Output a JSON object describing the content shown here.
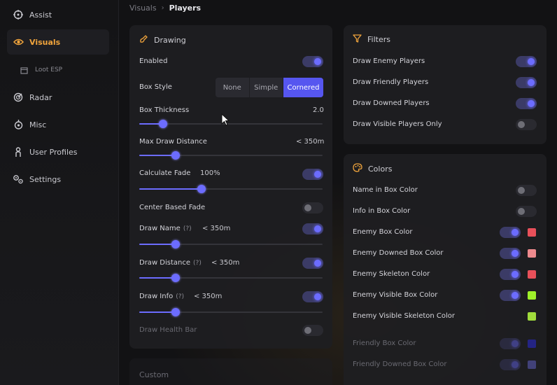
{
  "sidebar": {
    "items": [
      {
        "label": "Assist",
        "icon": "crosshair-icon"
      },
      {
        "label": "Visuals",
        "icon": "eye-icon"
      },
      {
        "label": "Loot ESP",
        "icon": "box-icon"
      },
      {
        "label": "Radar",
        "icon": "radar-icon"
      },
      {
        "label": "Misc",
        "icon": "drop-icon"
      },
      {
        "label": "User Profiles",
        "icon": "user-icon"
      },
      {
        "label": "Settings",
        "icon": "gear-icon"
      }
    ],
    "active_color": "#f0a43c"
  },
  "breadcrumb": {
    "parent": "Visuals",
    "separator": "›",
    "current": "Players"
  },
  "drawing": {
    "title": "Drawing",
    "enabled_label": "Enabled",
    "enabled": true,
    "box_style_label": "Box Style",
    "box_style_options": [
      "None",
      "Simple",
      "Cornered"
    ],
    "box_style_selected": "Cornered",
    "box_thickness_label": "Box Thickness",
    "box_thickness_value": "2.0",
    "box_thickness_fraction": 0.13,
    "max_draw_distance_label": "Max Draw Distance",
    "max_draw_distance_value": "< 350m",
    "max_draw_distance_fraction": 0.2,
    "calculate_fade_label": "Calculate Fade",
    "calculate_fade_value": "100%",
    "calculate_fade_enabled": true,
    "calculate_fade_fraction": 0.34,
    "center_based_fade_label": "Center Based Fade",
    "center_based_fade_enabled": false,
    "draw_name_label": "Draw Name",
    "draw_name_help": "(?)",
    "draw_name_value": "< 350m",
    "draw_name_enabled": true,
    "draw_name_fraction": 0.2,
    "draw_distance_label": "Draw Distance",
    "draw_distance_help": "(?)",
    "draw_distance_value": "< 350m",
    "draw_distance_enabled": true,
    "draw_distance_fraction": 0.2,
    "draw_info_label": "Draw Info",
    "draw_info_help": "(?)",
    "draw_info_value": "< 350m",
    "draw_info_enabled": true,
    "draw_info_fraction": 0.2,
    "draw_health_bar_label": "Draw Health Bar",
    "draw_health_bar_enabled": false
  },
  "custom": {
    "title": "Custom"
  },
  "filters": {
    "title": "Filters",
    "items": [
      {
        "label": "Draw Enemy Players",
        "enabled": true
      },
      {
        "label": "Draw Friendly Players",
        "enabled": true
      },
      {
        "label": "Draw Downed Players",
        "enabled": true
      },
      {
        "label": "Draw Visible Players Only",
        "enabled": false
      }
    ]
  },
  "colors": {
    "title": "Colors",
    "items": [
      {
        "label": "Name in Box Color",
        "toggle": false,
        "color": null
      },
      {
        "label": "Info in Box Color",
        "toggle": false,
        "color": null
      },
      {
        "label": "Enemy Box Color",
        "toggle": true,
        "color": "#e8505a"
      },
      {
        "label": "Enemy Downed Box Color",
        "toggle": true,
        "color": "#ee8a8e"
      },
      {
        "label": "Enemy Skeleton Color",
        "toggle": true,
        "color": "#e8505a"
      },
      {
        "label": "Enemy Visible Box Color",
        "toggle": true,
        "color": "#9ef02a"
      },
      {
        "label": "Enemy Visible Skeleton Color",
        "toggle": null,
        "color": "#a0dc3c"
      },
      {
        "label": "Friendly Box Color",
        "toggle": true,
        "color": "#2a2ac8"
      },
      {
        "label": "Friendly Downed Box Color",
        "toggle": true,
        "color": "#5a5ab4"
      }
    ]
  },
  "accent_color": "#6c6cff"
}
